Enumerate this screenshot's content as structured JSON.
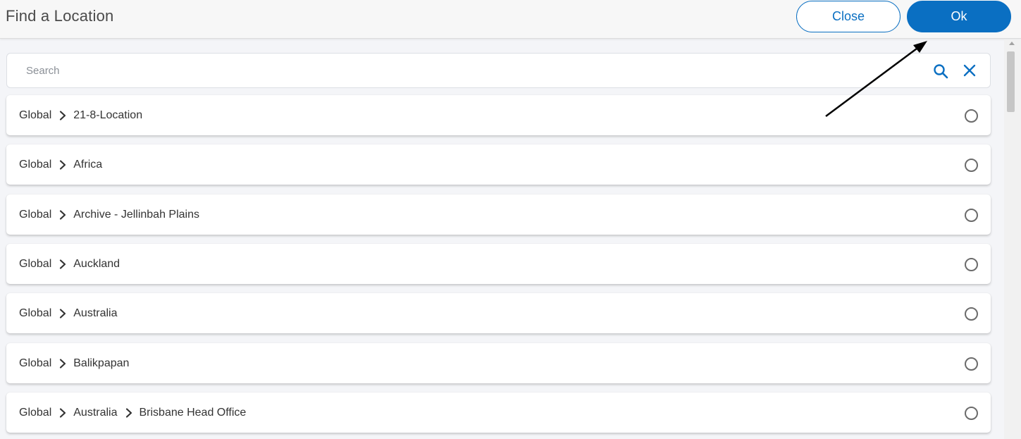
{
  "header": {
    "title": "Find a Location",
    "close_label": "Close",
    "ok_label": "Ok"
  },
  "search": {
    "placeholder": "Search"
  },
  "locations": [
    {
      "path": [
        "Global",
        "21-8-Location"
      ]
    },
    {
      "path": [
        "Global",
        "Africa"
      ]
    },
    {
      "path": [
        "Global",
        "Archive - Jellinbah Plains"
      ]
    },
    {
      "path": [
        "Global",
        "Auckland"
      ]
    },
    {
      "path": [
        "Global",
        "Australia"
      ]
    },
    {
      "path": [
        "Global",
        "Balikpapan"
      ]
    },
    {
      "path": [
        "Global",
        "Australia",
        "Brisbane Head Office"
      ]
    }
  ],
  "colors": {
    "accent": "#0a6fc2",
    "background": "#f4f5f8",
    "annotation_arrow": "#000000"
  },
  "icons": {
    "search": "search-icon",
    "clear": "close-icon",
    "separator": "chevron-right-icon",
    "selector": "radio-unselected-icon"
  }
}
